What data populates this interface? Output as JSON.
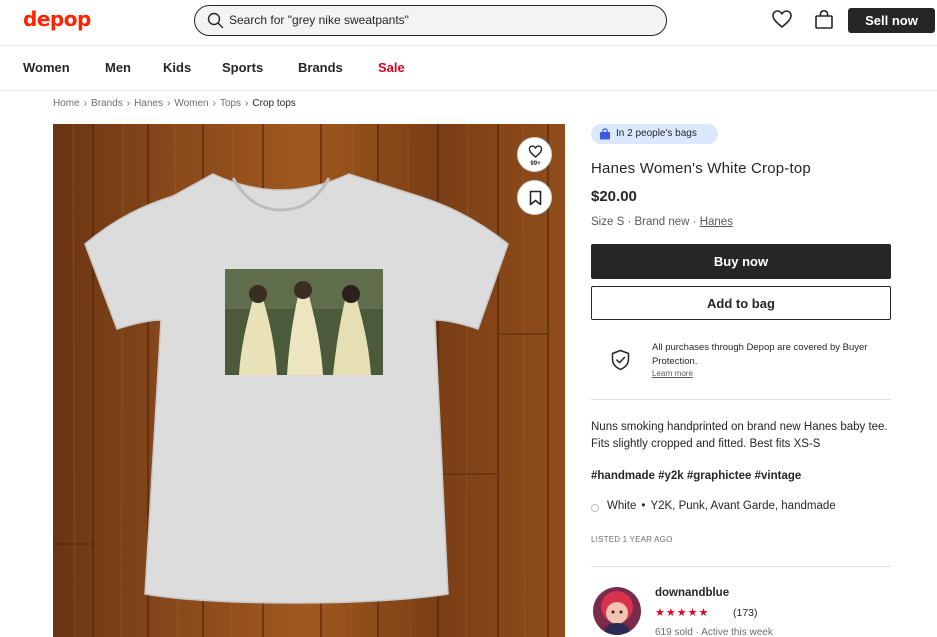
{
  "header": {
    "logo": "depop",
    "search_placeholder": "Search for \"grey nike sweatpants\"",
    "icons": [
      "heart-icon",
      "bag-icon"
    ],
    "sell_label": "Sell now"
  },
  "nav": {
    "women": "Women",
    "men": "Men",
    "kids": "Kids",
    "sports": "Sports",
    "brands": "Brands",
    "sale": "Sale"
  },
  "breadcrumbs": [
    "Home",
    "Brands",
    "Hanes",
    "Women",
    "Tops",
    "Crop tops"
  ],
  "photo": {
    "like_count": "99+",
    "icons": [
      "heart-icon",
      "bookmark-icon"
    ]
  },
  "product": {
    "bags_badge": "In 2 people's bags",
    "title": "Hanes Women's White Crop-top",
    "price": "$20.00",
    "size": "Size S",
    "condition": "Brand new",
    "brand": "Hanes",
    "buy_label": "Buy now",
    "add_label": "Add to bag",
    "protection_text": "All purchases through Depop are covered by Buyer Protection.",
    "learn_more": "Learn more",
    "description": "Nuns smoking handprinted on brand new Hanes baby tee. Fits slightly cropped and fitted. Best fits XS-S",
    "tags": "#handmade #y2k #graphictee #vintage",
    "color": "White",
    "styles": "Y2K, Punk, Avant Garde, handmade",
    "listed": "LISTED 1 YEAR AGO"
  },
  "seller": {
    "name": "downandblue",
    "stars": "★★★★★",
    "rating_count": "(173)",
    "meta": "619 sold · Active this week"
  },
  "colors": {
    "brand_red": "#ff2300",
    "sale_red": "#e00024",
    "dark": "#262626",
    "badge_blue": "#dbe8ff"
  }
}
